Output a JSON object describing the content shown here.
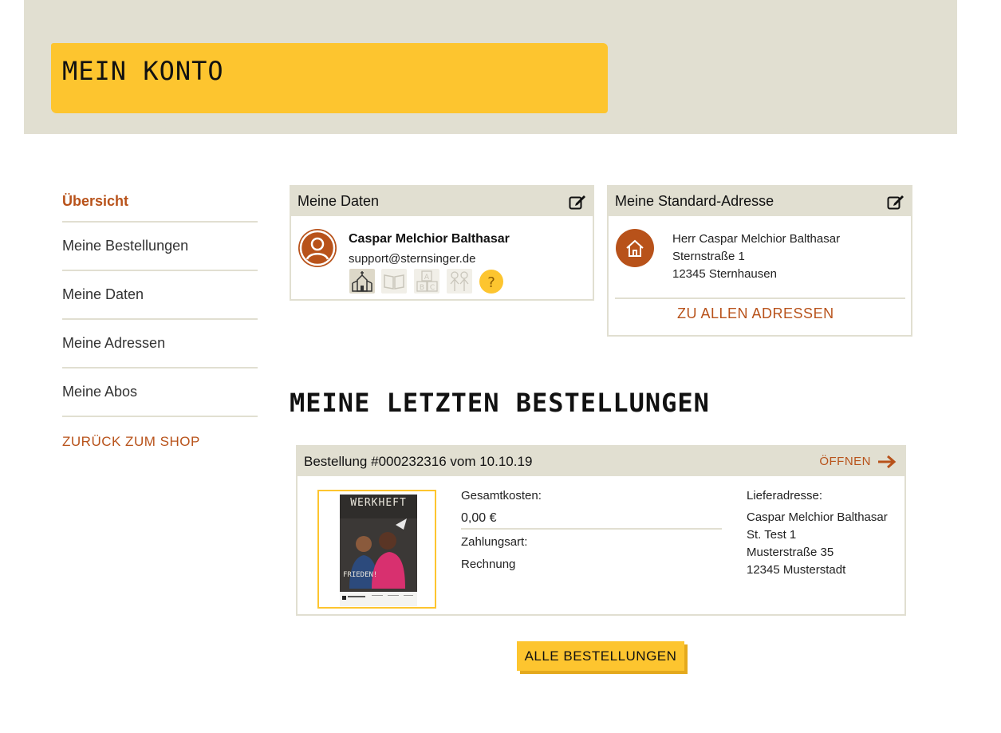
{
  "header": {
    "title": "MEIN KONTO"
  },
  "sidebar": {
    "items": [
      {
        "label": "Übersicht",
        "active": true
      },
      {
        "label": "Meine Bestellungen"
      },
      {
        "label": "Meine Daten"
      },
      {
        "label": "Meine Adressen"
      },
      {
        "label": "Meine Abos"
      }
    ],
    "back_label": "ZURÜCK ZUM SHOP"
  },
  "my_data": {
    "title": "Meine Daten",
    "name": "Caspar Melchior Balthasar",
    "email": "support@sternsinger.de",
    "badges": [
      "church-icon",
      "book-icon",
      "abc-blocks-icon",
      "children-icon",
      "help-icon"
    ],
    "help_glyph": "?"
  },
  "default_address": {
    "title": "Meine Standard-Adresse",
    "line1": "Herr Caspar Melchior Balthasar",
    "line2": "Sternstraße 1",
    "line3": "12345 Sternhausen",
    "all_addresses_label": "ZU ALLEN ADRESSEN"
  },
  "orders_section": {
    "title": "MEINE LETZTEN BESTELLUNGEN"
  },
  "order": {
    "heading": "Bestellung #000232316 vom 10.10.19",
    "open_label": "ÖFFNEN",
    "cover_title": "WERKHEFT",
    "cover_subtitle": "FRIEDEN!",
    "total_label": "Gesamtkosten:",
    "total_value": "0,00 €",
    "payment_label": "Zahlungsart:",
    "payment_value": "Rechnung",
    "delivery_label": "Lieferadresse:",
    "delivery_lines": [
      "Caspar Melchior Balthasar",
      "St. Test 1",
      "Musterstraße 35",
      "12345 Musterstadt"
    ]
  },
  "all_orders_button": "ALLE BESTELLUNGEN",
  "colors": {
    "accent": "#b8521a",
    "yellow": "#fdc52f",
    "beige": "#e1dfd1"
  }
}
